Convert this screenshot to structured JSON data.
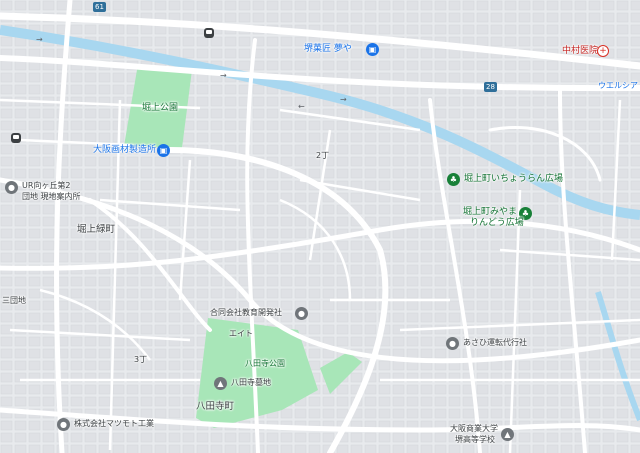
{
  "colors": {
    "water": "#a8d7f0",
    "park": "#a8e6b8",
    "road": "#ffffff",
    "background": "#e8eaed",
    "label_green": "#137333",
    "label_red": "#c5221f",
    "label_blue": "#1a73e8"
  },
  "labels": {
    "horigami_park": "堀上公園",
    "osaka_gazai": "大阪画材製造所",
    "sakai_meika": "堺菓匠 夢や",
    "nakamura_clinic": "中村医院",
    "welcia": "ウエルシア",
    "chome2": "2丁",
    "ur_mukogaoka": "UR向ヶ丘第2",
    "ur_mukogaoka_2": "団地 現地案内所",
    "horigami_ryokucho": "堀上緑町",
    "icho_hiroba": "堀上町いちょうらん広場",
    "miyama_hiroba_1": "堀上町みやま",
    "miyama_hiroba_2": "りんどう広場",
    "danchi": "三団地",
    "godo_kyoiku": "合同会社教育開発社",
    "eito": "エイト",
    "hattaji_park": "八田寺公園",
    "hattaji_bochi": "八田寺墓地",
    "chome3": "3丁",
    "hattaji_town": "八田寺町",
    "asahi_unten": "あさひ運転代行社",
    "matsumoto": "株式会社マツモト工業",
    "osaka_shogyo_1": "大阪商業大学",
    "osaka_shogyo_2": "堺高等学校",
    "route_61": "61",
    "route_28": "28"
  },
  "icons": {
    "park_pin": "park-icon",
    "shop_pin": "bag-icon",
    "hospital_pin": "cross-icon",
    "business_pin": "gray-circle-icon",
    "cemetery_pin": "cemetery-icon",
    "school_pin": "school-icon",
    "bus_stop": "bus-icon"
  }
}
